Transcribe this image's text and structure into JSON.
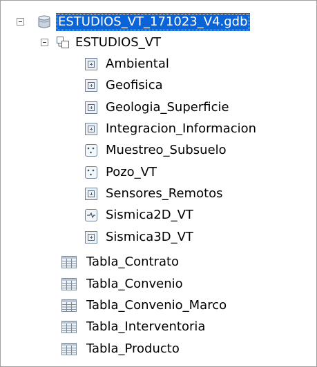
{
  "tree": {
    "geodatabase": {
      "label": "ESTUDIOS_VT_171023_V4.gdb",
      "icon": "database-icon",
      "expanded": true,
      "selected": true
    },
    "feature_dataset": {
      "label": "ESTUDIOS_VT",
      "icon": "feature-dataset-icon",
      "expanded": true
    },
    "feature_classes": [
      {
        "label": "Ambiental",
        "icon": "polygon-feature-class-icon"
      },
      {
        "label": "Geofisica",
        "icon": "polygon-feature-class-icon"
      },
      {
        "label": "Geologia_Superficie",
        "icon": "polygon-feature-class-icon"
      },
      {
        "label": "Integracion_Informacion",
        "icon": "polygon-feature-class-icon"
      },
      {
        "label": "Muestreo_Subsuelo",
        "icon": "point-feature-class-icon"
      },
      {
        "label": "Pozo_VT",
        "icon": "point-feature-class-icon"
      },
      {
        "label": "Sensores_Remotos",
        "icon": "polygon-feature-class-icon"
      },
      {
        "label": "Sismica2D_VT",
        "icon": "line-feature-class-icon"
      },
      {
        "label": "Sismica3D_VT",
        "icon": "polygon-feature-class-icon"
      }
    ],
    "tables": [
      {
        "label": "Tabla_Contrato",
        "icon": "table-icon"
      },
      {
        "label": "Tabla_Convenio",
        "icon": "table-icon"
      },
      {
        "label": "Tabla_Convenio_Marco",
        "icon": "table-icon"
      },
      {
        "label": "Tabla_Interventoria",
        "icon": "table-icon"
      },
      {
        "label": "Tabla_Producto",
        "icon": "table-icon"
      }
    ]
  },
  "colors": {
    "selection": "#0a64d8",
    "selection_text": "#ffffff",
    "text": "#000000"
  }
}
